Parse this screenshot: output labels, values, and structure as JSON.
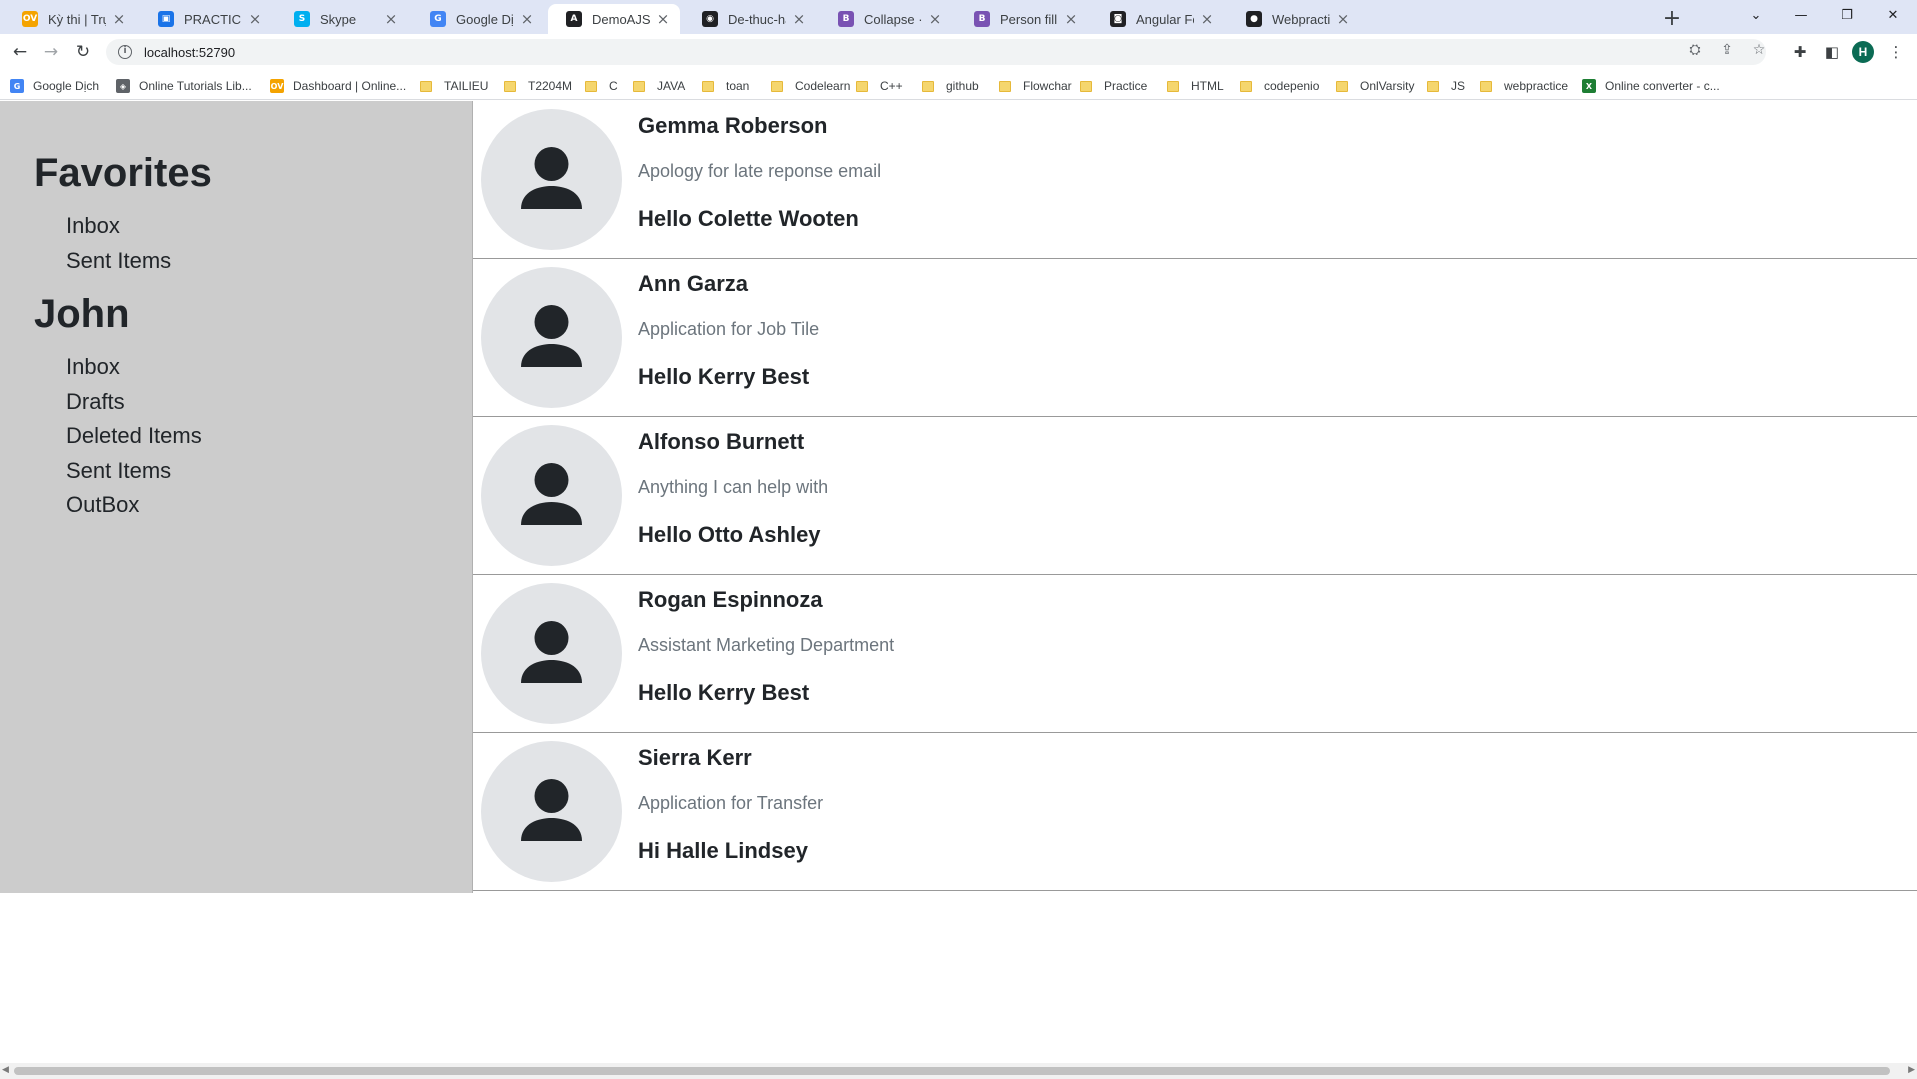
{
  "browser": {
    "tabs": [
      {
        "title": "Kỳ thi | Trực tuyến",
        "icon": "ov-favicon-icon",
        "color": "#f4a300",
        "glyph": "OV"
      },
      {
        "title": "PRACTICE EXAM",
        "icon": "contact-favicon-icon",
        "color": "#1a73e8",
        "glyph": "▣"
      },
      {
        "title": "Skype",
        "icon": "skype-favicon-icon",
        "color": "#00aff0",
        "glyph": "S"
      },
      {
        "title": "Google Dịch",
        "icon": "google-translate-favicon-icon",
        "color": "#4285f4",
        "glyph": "G"
      },
      {
        "title": "DemoAJS",
        "icon": "angular-favicon-icon",
        "color": "#202124",
        "glyph": "A"
      },
      {
        "title": "De-thuc-hanh-AJS",
        "icon": "globe-favicon-icon",
        "color": "#202124",
        "glyph": "◉"
      },
      {
        "title": "Collapse · Bootstra",
        "icon": "bootstrap-favicon-icon",
        "color": "#7952b3",
        "glyph": "B"
      },
      {
        "title": "Person fill · Bootstr",
        "icon": "bootstrap-favicon-icon",
        "color": "#7952b3",
        "glyph": "B"
      },
      {
        "title": "Angular Form Valid",
        "icon": "site-favicon-icon",
        "color": "#202124",
        "glyph": "◙"
      },
      {
        "title": "Webpractice.githu",
        "icon": "github-favicon-icon",
        "color": "#202124",
        "glyph": "●"
      }
    ],
    "active_tab": 4,
    "new_tab": "+",
    "url": "localhost:52790",
    "bookmarks": [
      {
        "label": "Google Dịch",
        "icon": "google-translate-bookmark-icon",
        "color": "#4285f4",
        "glyph": "G",
        "folder": false
      },
      {
        "label": "Online Tutorials Lib...",
        "icon": "tutorials-bookmark-icon",
        "color": "#5f6368",
        "glyph": "◈",
        "folder": false
      },
      {
        "label": "Dashboard | Online...",
        "icon": "ov-bookmark-icon",
        "color": "#f4a300",
        "glyph": "OV",
        "folder": false
      },
      {
        "label": "TAILIEU",
        "folder": true
      },
      {
        "label": "T2204M",
        "folder": true
      },
      {
        "label": "C",
        "folder": true
      },
      {
        "label": "JAVA",
        "folder": true
      },
      {
        "label": "toan",
        "folder": true
      },
      {
        "label": "Codelearn",
        "folder": true
      },
      {
        "label": "C++",
        "folder": true
      },
      {
        "label": "github",
        "folder": true
      },
      {
        "label": "Flowchar",
        "folder": true
      },
      {
        "label": "Practice",
        "folder": true
      },
      {
        "label": "HTML",
        "folder": true
      },
      {
        "label": "codepenio",
        "folder": true
      },
      {
        "label": "OnlVarsity",
        "folder": true
      },
      {
        "label": "JS",
        "folder": true
      },
      {
        "label": "webpractice",
        "folder": true
      },
      {
        "label": "Online converter - c...",
        "icon": "converter-bookmark-icon",
        "color": "#1e7e34",
        "glyph": "X",
        "folder": false
      }
    ],
    "profile_initial": "H"
  },
  "sidebar": {
    "groups": [
      {
        "heading": "Favorites",
        "items": [
          "Inbox",
          "Sent Items"
        ]
      },
      {
        "heading": "John",
        "items": [
          "Inbox",
          "Drafts",
          "Deleted Items",
          "Sent Items",
          "OutBox"
        ]
      }
    ]
  },
  "mails": [
    {
      "sender": "Gemma Roberson",
      "subject": "Apology for late reponse email",
      "greeting": "Hello Colette Wooten"
    },
    {
      "sender": "Ann Garza",
      "subject": "Application for Job Tile",
      "greeting": "Hello Kerry Best"
    },
    {
      "sender": "Alfonso Burnett",
      "subject": "Anything I can help with",
      "greeting": "Hello Otto Ashley"
    },
    {
      "sender": "Rogan Espinnoza",
      "subject": "Assistant Marketing Department",
      "greeting": "Hello Kerry Best"
    },
    {
      "sender": "Sierra Kerr",
      "subject": "Application for Transfer",
      "greeting": "Hi Halle Lindsey"
    }
  ]
}
